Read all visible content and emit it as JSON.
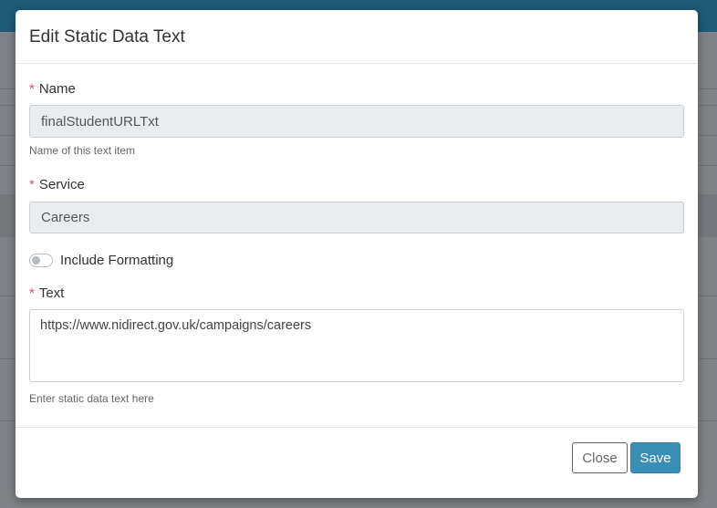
{
  "modal": {
    "title": "Edit Static Data Text",
    "fields": {
      "name": {
        "label": "Name",
        "required_mark": "*",
        "value": "finalStudentURLTxt",
        "help": "Name of this text item"
      },
      "service": {
        "label": "Service",
        "required_mark": "*",
        "value": "Careers"
      },
      "include_formatting": {
        "label": "Include Formatting",
        "checked": false
      },
      "text": {
        "label": "Text",
        "required_mark": "*",
        "value": "https://www.nidirect.gov.uk/campaigns/careers",
        "help": "Enter static data text here"
      }
    },
    "footer": {
      "close_label": "Close",
      "save_label": "Save"
    }
  },
  "colors": {
    "accent": "#3a8fb7",
    "required": "#d9534f",
    "topbar": "#1f5a77"
  }
}
